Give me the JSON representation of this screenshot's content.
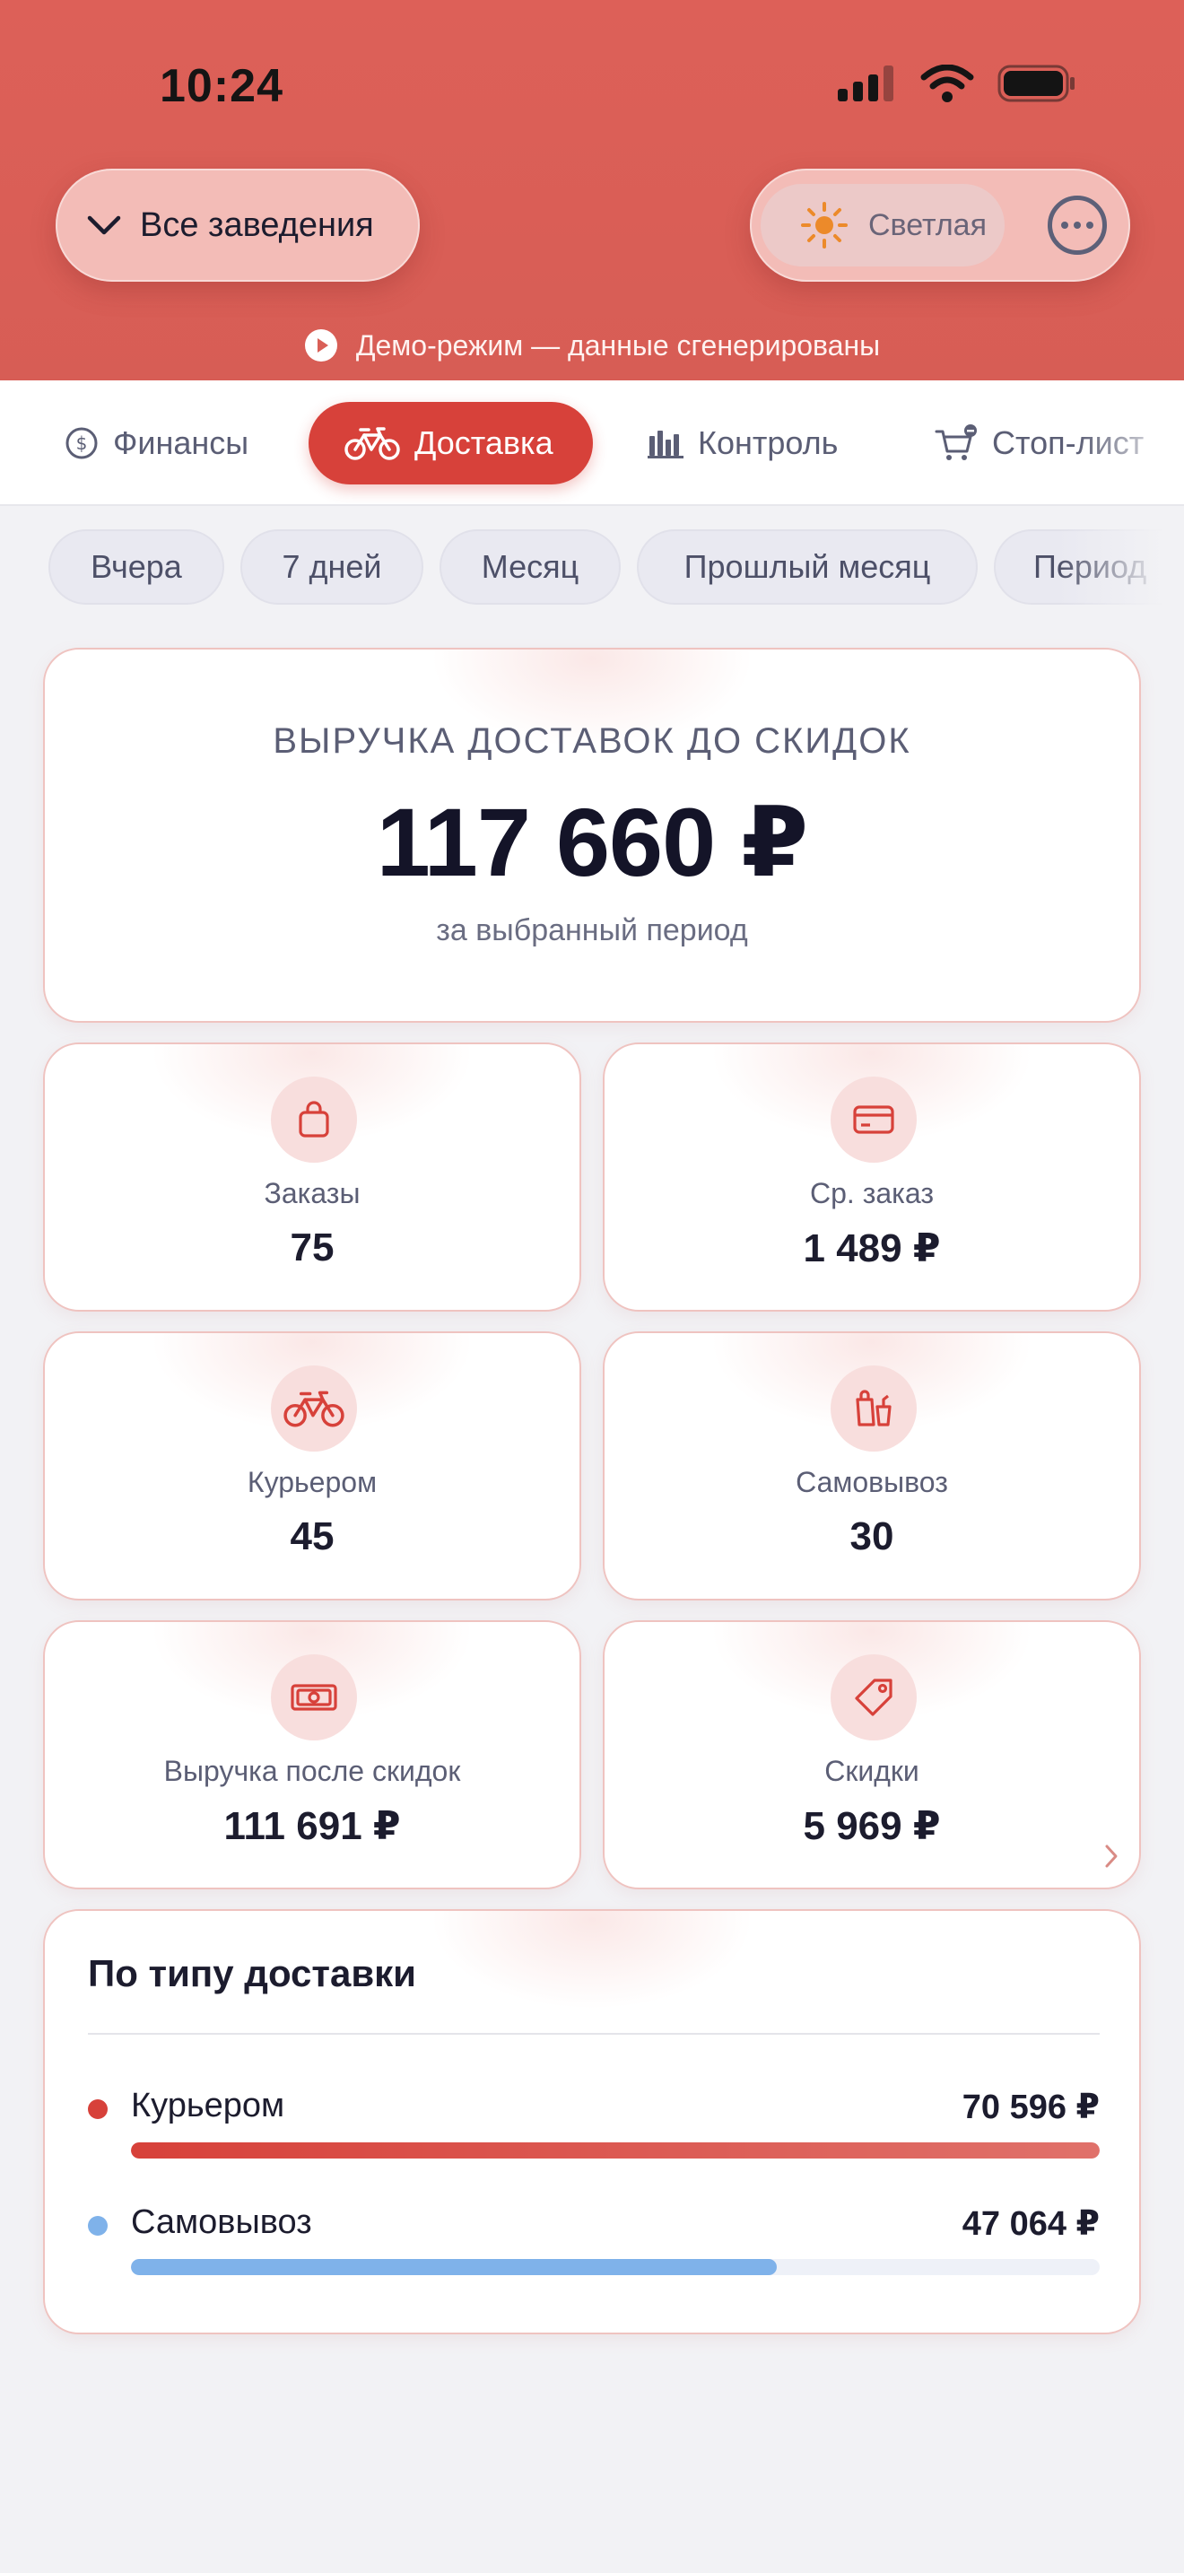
{
  "status_bar": {
    "time": "10:24",
    "icons": [
      "signal-icon",
      "wifi-icon",
      "battery-icon"
    ]
  },
  "header": {
    "venue_selector": "Все заведения",
    "theme_toggle": "Светлая",
    "demo_banner": "Демо-режим — данные сгенерированы"
  },
  "tabs": [
    {
      "label": "Финансы",
      "icon": "dollar-circle-icon",
      "active": false
    },
    {
      "label": "Доставка",
      "icon": "bicycle-icon",
      "active": true
    },
    {
      "label": "Контроль",
      "icon": "bar-chart-icon",
      "active": false
    },
    {
      "label": "Стоп-лист",
      "icon": "cart-minus-icon",
      "active": false
    }
  ],
  "periods": [
    "Вчера",
    "7 дней",
    "Месяц",
    "Прошлый месяц",
    "Период"
  ],
  "revenue": {
    "title": "ВЫРУЧКА ДОСТАВОК ДО СКИДОК",
    "value": "117 660 ₽",
    "subtitle": "за выбранный период"
  },
  "metrics": [
    {
      "label": "Заказы",
      "value": "75",
      "icon": "bag-icon"
    },
    {
      "label": "Ср. заказ",
      "value": "1 489 ₽",
      "icon": "credit-card-icon"
    },
    {
      "label": "Курьером",
      "value": "45",
      "icon": "bicycle-icon"
    },
    {
      "label": "Самовывоз",
      "value": "30",
      "icon": "takeaway-bag-icon"
    },
    {
      "label": "Выручка после скидок",
      "value": "111 691 ₽",
      "icon": "banknote-icon"
    },
    {
      "label": "Скидки",
      "value": "5 969 ₽",
      "icon": "price-tag-icon"
    }
  ],
  "delivery_by_type": {
    "title": "По типу доставки",
    "rows": [
      {
        "name": "Курьером",
        "value": "70 596 ₽",
        "share": 1.0,
        "color": "#d7413a"
      },
      {
        "name": "Самовывоз",
        "value": "47 064 ₽",
        "share": 0.667,
        "color": "#7fb2ea"
      }
    ]
  },
  "colors": {
    "accent": "#d7413a",
    "header_bg": "#d95f57",
    "page_bg": "#f2f2f5",
    "pickup": "#7fb2ea"
  }
}
